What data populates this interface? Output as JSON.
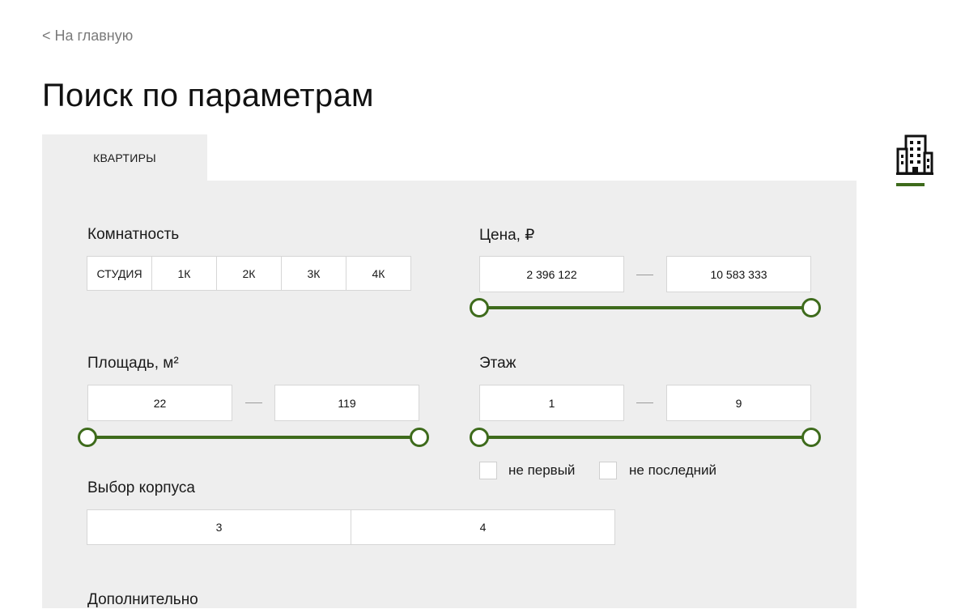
{
  "nav": {
    "back_label": "< На главную"
  },
  "page_title": "Поиск по параметрам",
  "tab": {
    "label": "КВАРТИРЫ"
  },
  "rooms": {
    "label": "Комнатность",
    "options": [
      "СТУДИЯ",
      "1К",
      "2К",
      "3К",
      "4К"
    ]
  },
  "price": {
    "label": "Цена, ₽",
    "min": "2 396 122",
    "max": "10 583 333",
    "slider_min_fraction": 0,
    "slider_max_fraction": 1
  },
  "area": {
    "label": "Площадь, м²",
    "min": "22",
    "max": "119",
    "slider_min_fraction": 0,
    "slider_max_fraction": 1
  },
  "floor": {
    "label": "Этаж",
    "min": "1",
    "max": "9",
    "slider_min_fraction": 0,
    "slider_max_fraction": 1,
    "not_first_label": "не первый",
    "not_last_label": "не последний"
  },
  "building": {
    "label": "Выбор корпуса",
    "options": [
      "3",
      "4"
    ]
  },
  "extra": {
    "label": "Дополнительно"
  },
  "sidebar": {
    "icon": "building-icon"
  },
  "colors": {
    "accent": "#3e6b1c",
    "panel_bg": "#eeeeee",
    "border": "#d6d6d6"
  }
}
